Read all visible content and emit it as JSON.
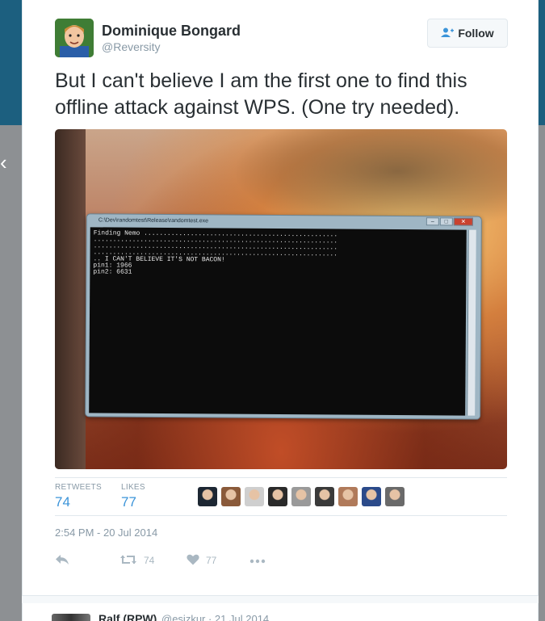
{
  "tweet": {
    "display_name": "Dominique Bongard",
    "handle": "@Reversity",
    "follow_label": "Follow",
    "text": "But I can't believe I am the first one to find this offline attack against WPS. (One try needed).",
    "media": {
      "window_title": "C:\\Dev\\randomtest\\Release\\randomtest.exe",
      "console_lines": [
        "Finding Nemo ..................................................",
        "...............................................................",
        "...............................................................",
        "...............................................................",
        ".. I CAN'T BELIEVE IT'S NOT BACON!",
        "",
        "pin1: 1966",
        "pin2: 6631"
      ]
    },
    "stats": {
      "retweets_label": "RETWEETS",
      "retweets": "74",
      "likes_label": "LIKES",
      "likes": "77",
      "liker_avatar_colors": [
        "#1d2733",
        "#8a5a3a",
        "#cfcfcf",
        "#2a2a2a",
        "#9a9a9a",
        "#3a3a3a",
        "#b07a5a",
        "#2b4a8a",
        "#6a6a6a"
      ]
    },
    "timestamp": "2:54 PM - 20 Jul 2014",
    "actions": {
      "retweet_count": "74",
      "like_count": "77"
    }
  },
  "reply": {
    "display_name": "Ralf (RPW)",
    "meta": "@esizkur · 21 Jul 2014"
  }
}
